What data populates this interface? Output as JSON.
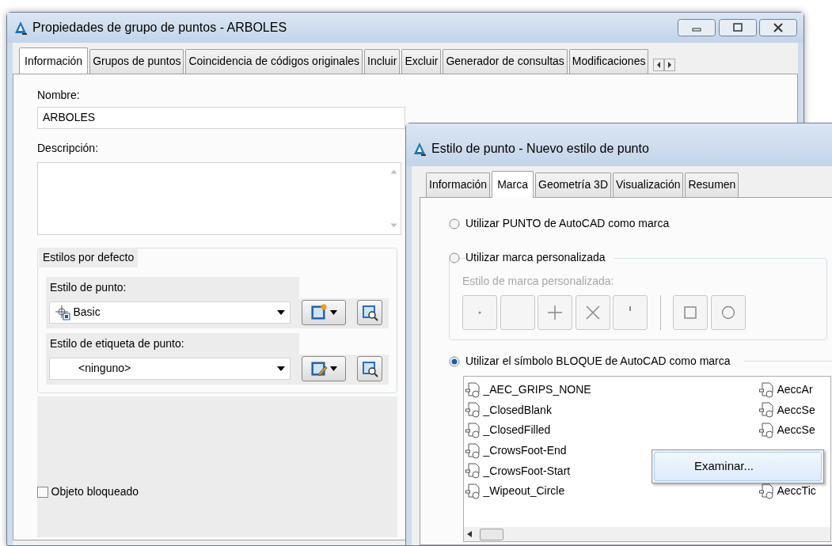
{
  "main_window": {
    "title": "Propiedades de grupo de puntos - ARBOLES",
    "tabs": [
      {
        "label": "Información",
        "selected": true
      },
      {
        "label": "Grupos de puntos",
        "selected": false
      },
      {
        "label": "Coincidencia de códigos originales",
        "selected": false
      },
      {
        "label": "Incluir",
        "selected": false
      },
      {
        "label": "Excluir",
        "selected": false
      },
      {
        "label": "Generador de consultas",
        "selected": false
      },
      {
        "label": "Modificaciones",
        "selected": false
      }
    ],
    "name": {
      "label": "Nombre:",
      "value": "ARBOLES"
    },
    "description": {
      "label": "Descripción:"
    },
    "default_styles": {
      "title": "Estilos por defecto",
      "point_style": {
        "label": "Estilo de punto:",
        "value": "Basic"
      },
      "label_style": {
        "label": "Estilo de etiqueta de punto:",
        "value": "<ninguno>"
      }
    },
    "locked": {
      "label": "Objeto bloqueado",
      "checked": false
    }
  },
  "style_window": {
    "title": "Estilo de punto - Nuevo estilo de punto",
    "tabs": [
      {
        "label": "Información",
        "selected": false
      },
      {
        "label": "Marca",
        "selected": true
      },
      {
        "label": "Geometría 3D",
        "selected": false
      },
      {
        "label": "Visualización",
        "selected": false
      },
      {
        "label": "Resumen",
        "selected": false
      }
    ],
    "options": [
      {
        "kind": "plain",
        "label": "Utilizar PUNTO de AutoCAD como marca",
        "selected": false
      },
      {
        "kind": "custom",
        "label": "Utilizar marca personalizada",
        "selected": false,
        "marker_styles": {
          "label": "Estilo de marca personalizada:",
          "disabled": true,
          "buttons": [
            {
              "kind": "dot"
            },
            {
              "kind": "none"
            },
            {
              "kind": "plus"
            },
            {
              "kind": "cross"
            },
            {
              "kind": "tick"
            },
            {
              "kind": "separator"
            },
            {
              "kind": "square"
            },
            {
              "kind": "circle"
            }
          ]
        }
      },
      {
        "kind": "block",
        "label": "Utilizar el símbolo BLOQUE de AutoCAD como marca",
        "selected": true,
        "blocks": [
          {
            "left": "_AEC_GRIPS_NONE",
            "right": "AeccAr"
          },
          {
            "left": "_ClosedBlank",
            "right": "AeccSe"
          },
          {
            "left": "_ClosedFilled",
            "right": "AeccSe"
          },
          {
            "left": "_CrowsFoot-End"
          },
          {
            "left": "_CrowsFoot-Start"
          },
          {
            "left": "_Wipeout_Circle",
            "right": "AeccTic"
          }
        ]
      }
    ],
    "context_menu": {
      "items": [
        "Examinar..."
      ]
    }
  }
}
